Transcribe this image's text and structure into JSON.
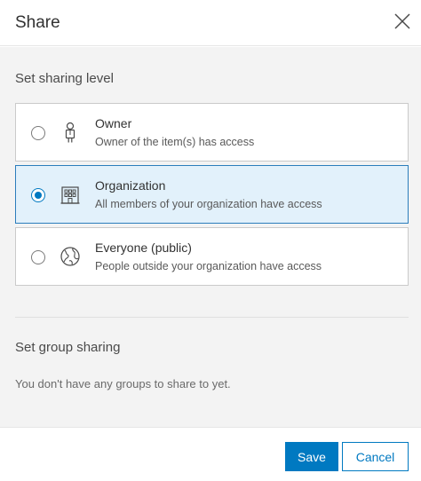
{
  "dialog": {
    "title": "Share",
    "close_icon": "close-icon"
  },
  "sharing_level": {
    "label": "Set sharing level",
    "options": [
      {
        "title": "Owner",
        "description": "Owner of the item(s) has access",
        "icon": "person-icon",
        "selected": false
      },
      {
        "title": "Organization",
        "description": "All members of your organization have access",
        "icon": "building-icon",
        "selected": true
      },
      {
        "title": "Everyone (public)",
        "description": "People outside your organization have access",
        "icon": "globe-icon",
        "selected": false
      }
    ]
  },
  "group_sharing": {
    "label": "Set group sharing",
    "empty_message": "You don't have any groups to share to yet."
  },
  "footer": {
    "save_label": "Save",
    "cancel_label": "Cancel"
  },
  "colors": {
    "accent": "#0079c1",
    "selected_bg": "#e2f1fb",
    "content_bg": "#f3f3f3"
  }
}
